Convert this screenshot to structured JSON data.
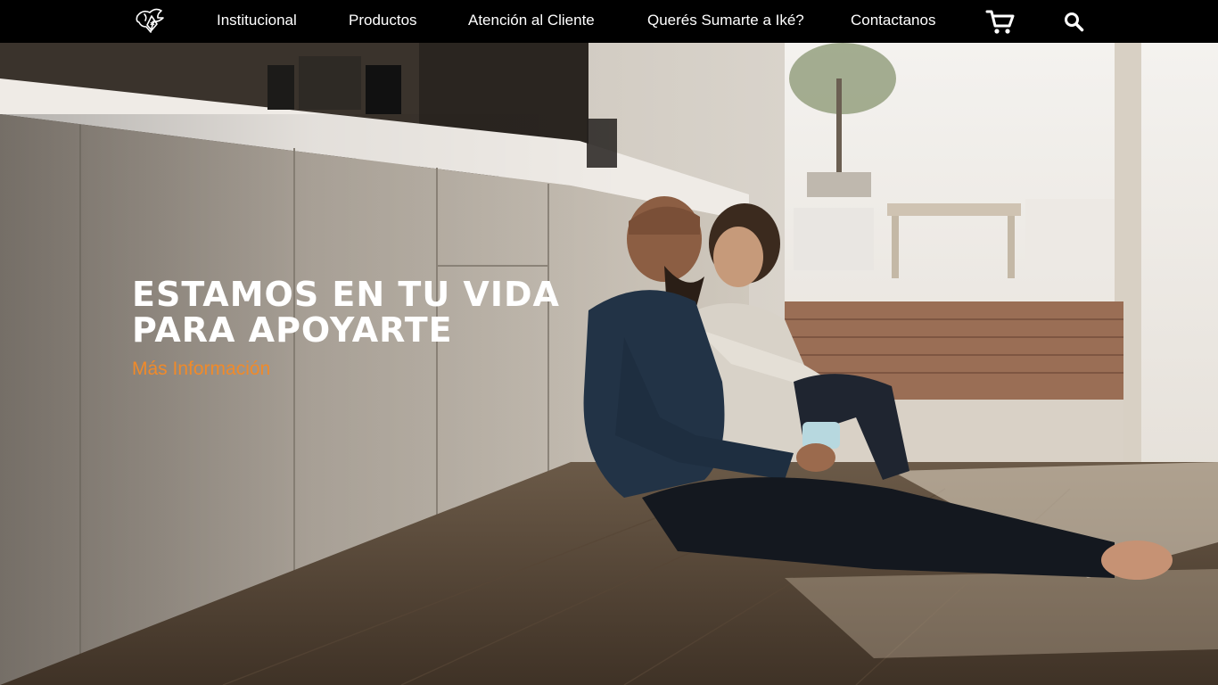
{
  "nav": {
    "logo_icon": "ike-bird-shield-logo",
    "items": [
      {
        "label": "Institucional"
      },
      {
        "label": "Productos"
      },
      {
        "label": "Atención al Cliente"
      },
      {
        "label": "Querés Sumarte a Iké?"
      },
      {
        "label": "Contactanos"
      }
    ],
    "cart_icon": "cart-icon",
    "search_icon": "search-icon"
  },
  "hero": {
    "title_line1": "ESTAMOS EN TU VIDA",
    "title_line2": "PARA APOYARTE",
    "link_label": "Más Información",
    "link_color": "#f08a2a"
  },
  "colors": {
    "navbar_bg": "#000000",
    "nav_text": "#ffffff",
    "accent": "#f08a2a"
  }
}
